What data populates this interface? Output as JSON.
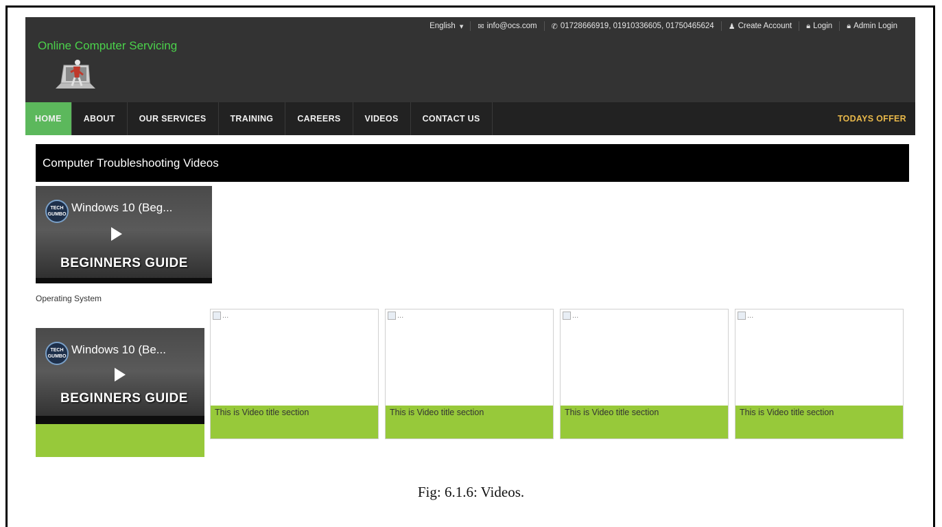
{
  "brand": {
    "name": "Online Computer Servicing"
  },
  "topbar": {
    "language": "English",
    "email": "info@ocs.com",
    "phones": "01728666919, 01910336605, 01750465624",
    "create_account": "Create Account",
    "login": "Login",
    "admin_login": "Admin Login"
  },
  "nav": {
    "items": [
      "HOME",
      "ABOUT",
      "OUR SERVICES",
      "TRAINING",
      "CAREERS",
      "VIDEOS",
      "CONTACT US"
    ],
    "offer": "TODAYS OFFER"
  },
  "section": {
    "title": "Computer Troubleshooting Videos"
  },
  "featured": {
    "title": "Windows 10 (Beg...",
    "channel": "TECH GUMBO",
    "banner": "BEGINNERS GUIDE",
    "category": "Operating System"
  },
  "featured2": {
    "title": "Windows 10 (Be...",
    "channel": "TECH GUMBO",
    "banner": "BEGINNERS GUIDE"
  },
  "cards": [
    {
      "alt": "...",
      "caption": "This is Video title section"
    },
    {
      "alt": "...",
      "caption": "This is Video title section"
    },
    {
      "alt": "...",
      "caption": "This is Video title section"
    },
    {
      "alt": "...",
      "caption": "This is Video title section"
    }
  ],
  "figure_caption": "Fig: 6.1.6:  Videos.",
  "colors": {
    "header": "#333333",
    "nav": "#222222",
    "active": "#5cb85c",
    "brand": "#4bd24b",
    "offer": "#e8b84a",
    "caption_bg": "#97c93a"
  }
}
